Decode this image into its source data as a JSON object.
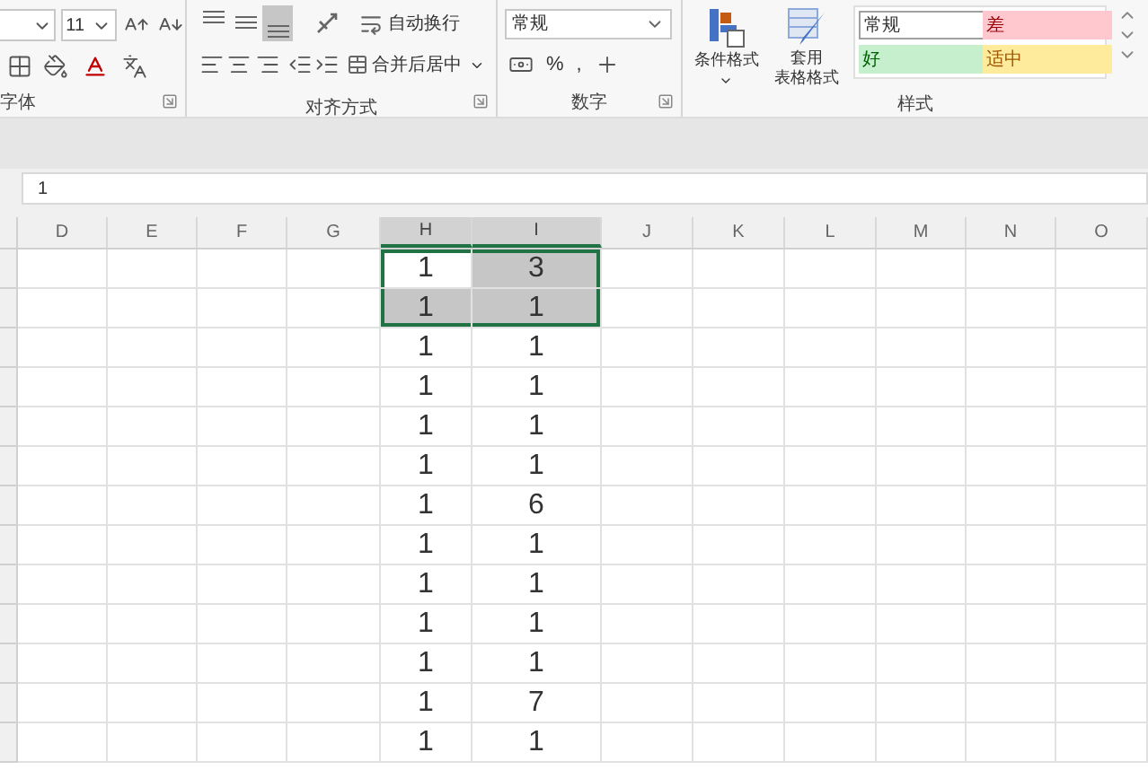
{
  "ribbon": {
    "font": {
      "size": "11",
      "label": "字体"
    },
    "alignment": {
      "vertical": [
        {
          "kind": "top",
          "selected": false
        },
        {
          "kind": "middle",
          "selected": false
        },
        {
          "kind": "bottom",
          "selected": true
        }
      ],
      "wrap": "自动换行",
      "merge": "合并后居中",
      "label": "对齐方式"
    },
    "number": {
      "format": "常规",
      "percent": "%",
      "comma": ",",
      "label": "数字"
    },
    "styles": {
      "conditional": "条件格式",
      "table_1": "套用",
      "table_2": "表格格式",
      "gallery": [
        {
          "label": "常规",
          "color": "#ffffff"
        },
        {
          "label": "差",
          "color": "#ffc7ce"
        },
        {
          "label": "好",
          "color": "#c6efce"
        },
        {
          "label": "适中",
          "color": "#ffeb9c"
        }
      ],
      "label": "样式"
    }
  },
  "formula_bar": {
    "value": "1"
  },
  "columns": [
    {
      "label": "D",
      "selected": false
    },
    {
      "label": "E",
      "selected": false
    },
    {
      "label": "F",
      "selected": false
    },
    {
      "label": "G",
      "selected": false
    },
    {
      "label": "H",
      "selected": true
    },
    {
      "label": "I",
      "selected": true
    },
    {
      "label": "J",
      "selected": false
    },
    {
      "label": "K",
      "selected": false
    },
    {
      "label": "L",
      "selected": false
    },
    {
      "label": "M",
      "selected": false
    },
    {
      "label": "N",
      "selected": false
    },
    {
      "label": "O",
      "selected": false
    }
  ],
  "rows": [
    [
      {
        "value": "1",
        "active": true,
        "selected": false
      },
      {
        "value": "3",
        "active": false,
        "selected": true
      }
    ],
    [
      {
        "value": "1",
        "active": false,
        "selected": true
      },
      {
        "value": "1",
        "active": false,
        "selected": true
      }
    ],
    [
      {
        "value": "1",
        "active": false,
        "selected": false
      },
      {
        "value": "1",
        "active": false,
        "selected": false
      }
    ],
    [
      {
        "value": "1",
        "active": false,
        "selected": false
      },
      {
        "value": "1",
        "active": false,
        "selected": false
      }
    ],
    [
      {
        "value": "1",
        "active": false,
        "selected": false
      },
      {
        "value": "1",
        "active": false,
        "selected": false
      }
    ],
    [
      {
        "value": "1",
        "active": false,
        "selected": false
      },
      {
        "value": "1",
        "active": false,
        "selected": false
      }
    ],
    [
      {
        "value": "1",
        "active": false,
        "selected": false
      },
      {
        "value": "6",
        "active": false,
        "selected": false
      }
    ],
    [
      {
        "value": "1",
        "active": false,
        "selected": false
      },
      {
        "value": "1",
        "active": false,
        "selected": false
      }
    ],
    [
      {
        "value": "1",
        "active": false,
        "selected": false
      },
      {
        "value": "1",
        "active": false,
        "selected": false
      }
    ],
    [
      {
        "value": "1",
        "active": false,
        "selected": false
      },
      {
        "value": "1",
        "active": false,
        "selected": false
      }
    ],
    [
      {
        "value": "1",
        "active": false,
        "selected": false
      },
      {
        "value": "1",
        "active": false,
        "selected": false
      }
    ],
    [
      {
        "value": "1",
        "active": false,
        "selected": false
      },
      {
        "value": "7",
        "active": false,
        "selected": false
      }
    ],
    [
      {
        "value": "1",
        "active": false,
        "selected": false
      },
      {
        "value": "1",
        "active": false,
        "selected": false
      }
    ]
  ]
}
